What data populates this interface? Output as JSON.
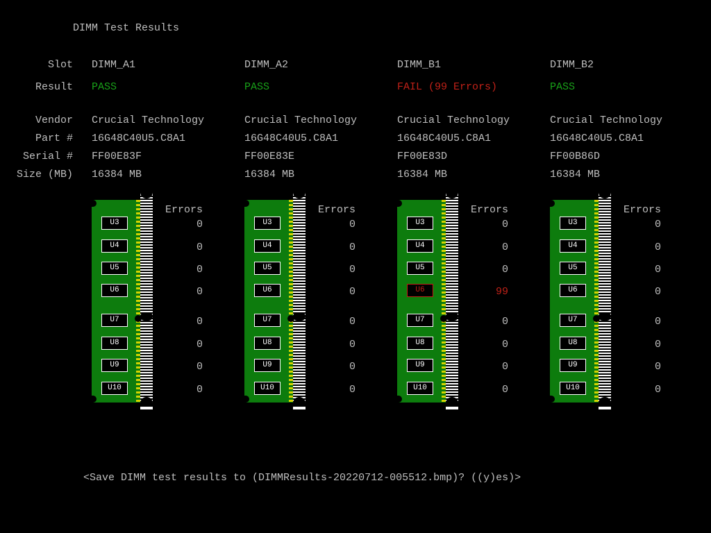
{
  "title": "DIMM Test Results",
  "labels": {
    "slot": "Slot",
    "result": "Result",
    "vendor": "Vendor",
    "part": "Part #",
    "serial": "Serial #",
    "size": "Size (MB)",
    "errors": "Errors"
  },
  "results": {
    "pass": "PASS",
    "fail_format": "FAIL ({n} Errors)"
  },
  "slots": [
    {
      "slot": "DIMM_A1",
      "pass": true,
      "vendor": "Crucial Technology",
      "part": "16G48C40U5.C8A1",
      "serial": "FF00E83F",
      "size": "16384 MB",
      "chips": [
        {
          "name": "U3",
          "errors": 0
        },
        {
          "name": "U4",
          "errors": 0
        },
        {
          "name": "U5",
          "errors": 0
        },
        {
          "name": "U6",
          "errors": 0
        },
        {
          "name": "U7",
          "errors": 0
        },
        {
          "name": "U8",
          "errors": 0
        },
        {
          "name": "U9",
          "errors": 0
        },
        {
          "name": "U10",
          "errors": 0
        }
      ]
    },
    {
      "slot": "DIMM_A2",
      "pass": true,
      "vendor": "Crucial Technology",
      "part": "16G48C40U5.C8A1",
      "serial": "FF00E83E",
      "size": "16384 MB",
      "chips": [
        {
          "name": "U3",
          "errors": 0
        },
        {
          "name": "U4",
          "errors": 0
        },
        {
          "name": "U5",
          "errors": 0
        },
        {
          "name": "U6",
          "errors": 0
        },
        {
          "name": "U7",
          "errors": 0
        },
        {
          "name": "U8",
          "errors": 0
        },
        {
          "name": "U9",
          "errors": 0
        },
        {
          "name": "U10",
          "errors": 0
        }
      ]
    },
    {
      "slot": "DIMM_B1",
      "pass": false,
      "error_count": 99,
      "vendor": "Crucial Technology",
      "part": "16G48C40U5.C8A1",
      "serial": "FF00E83D",
      "size": "16384 MB",
      "chips": [
        {
          "name": "U3",
          "errors": 0
        },
        {
          "name": "U4",
          "errors": 0
        },
        {
          "name": "U5",
          "errors": 0
        },
        {
          "name": "U6",
          "errors": 99
        },
        {
          "name": "U7",
          "errors": 0
        },
        {
          "name": "U8",
          "errors": 0
        },
        {
          "name": "U9",
          "errors": 0
        },
        {
          "name": "U10",
          "errors": 0
        }
      ]
    },
    {
      "slot": "DIMM_B2",
      "pass": true,
      "vendor": "Crucial Technology",
      "part": "16G48C40U5.C8A1",
      "serial": "FF00B86D",
      "size": "16384 MB",
      "chips": [
        {
          "name": "U3",
          "errors": 0
        },
        {
          "name": "U4",
          "errors": 0
        },
        {
          "name": "U5",
          "errors": 0
        },
        {
          "name": "U6",
          "errors": 0
        },
        {
          "name": "U7",
          "errors": 0
        },
        {
          "name": "U8",
          "errors": 0
        },
        {
          "name": "U9",
          "errors": 0
        },
        {
          "name": "U10",
          "errors": 0
        }
      ]
    }
  ],
  "prompt": "<Save DIMM test results to (DIMMResults-20220712-005512.bmp)? ((y)es)>"
}
